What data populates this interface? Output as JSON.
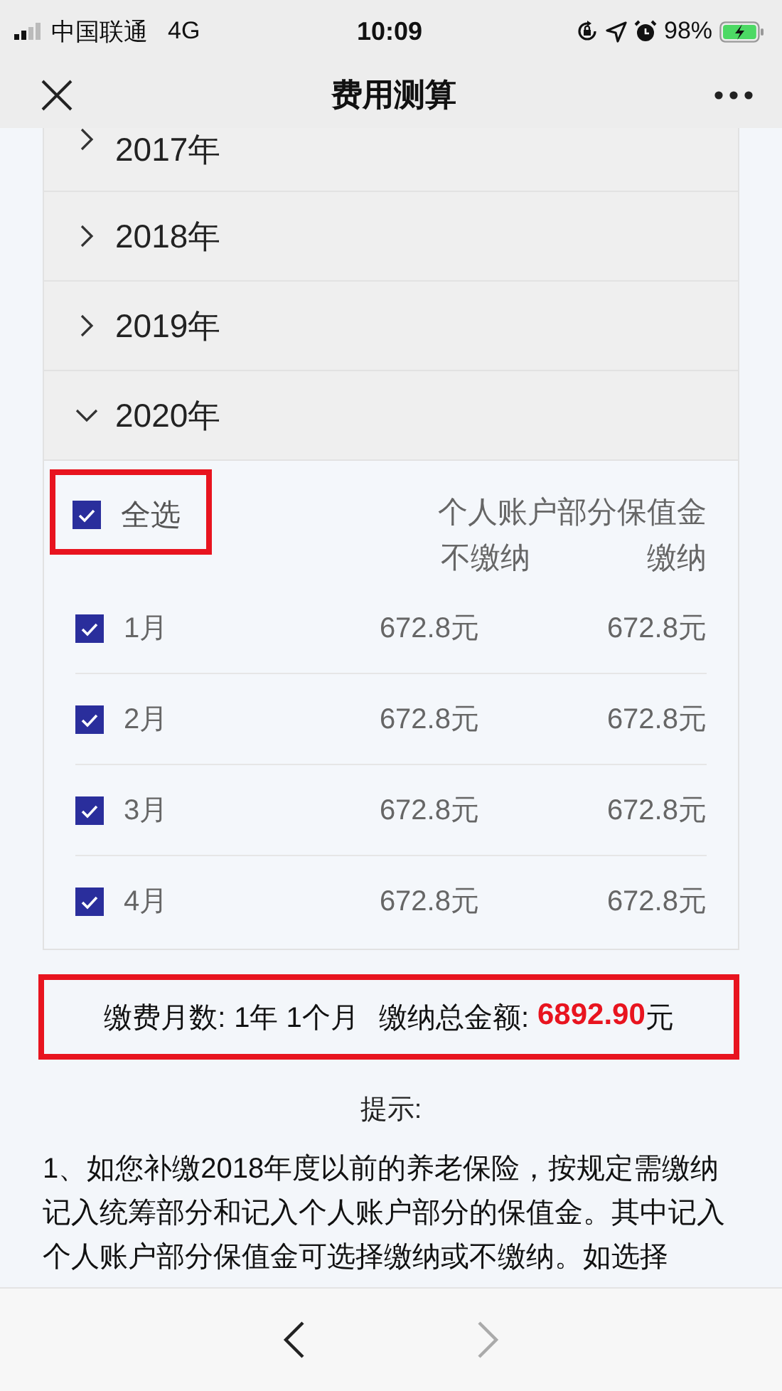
{
  "status_bar": {
    "carrier": "中国联通",
    "network": "4G",
    "time": "10:09",
    "battery": "98%"
  },
  "nav_bar": {
    "title": "费用测算"
  },
  "years": [
    {
      "label": "2017年",
      "expanded": false
    },
    {
      "label": "2018年",
      "expanded": false
    },
    {
      "label": "2019年",
      "expanded": false
    },
    {
      "label": "2020年",
      "expanded": true
    }
  ],
  "month_table": {
    "select_all": {
      "label": "全选",
      "checked": true,
      "highlighted": true
    },
    "group_heading": "个人账户部分保值金",
    "columns": [
      "不缴纳",
      "缴纳"
    ],
    "rows": [
      {
        "month": "1月",
        "checked": true,
        "unpaid": "672.8元",
        "paid": "672.8元"
      },
      {
        "month": "2月",
        "checked": true,
        "unpaid": "672.8元",
        "paid": "672.8元"
      },
      {
        "month": "3月",
        "checked": true,
        "unpaid": "672.8元",
        "paid": "672.8元"
      },
      {
        "month": "4月",
        "checked": true,
        "unpaid": "672.8元",
        "paid": "672.8元"
      }
    ]
  },
  "summary": {
    "highlighted": true,
    "months_label": "缴费月数:",
    "months_value": "1年 1个月",
    "total_label": "缴纳总金额:",
    "total_amount": "6892.90",
    "total_unit": "元"
  },
  "tips": {
    "title": "提示:",
    "text": "1、如您补缴2018年度以前的养老保险，按规定需缴纳记入统筹部分和记入个人账户部分的保值金。其中记入个人账户部分保值金可选择缴纳或不缴纳。如选择"
  },
  "toolbar": {
    "back_disabled": false,
    "forward_disabled": true
  }
}
